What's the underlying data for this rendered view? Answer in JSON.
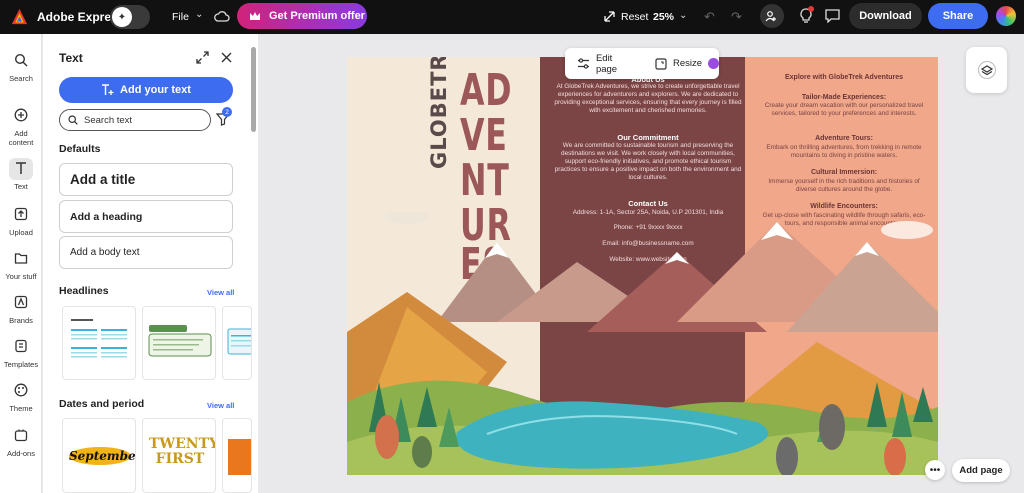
{
  "topbar": {
    "brand": "Adobe Express",
    "file_label": "File",
    "premium_label": "Get Premium offer",
    "reset_label": "Reset",
    "zoom_label": "25%",
    "download_label": "Download",
    "share_label": "Share"
  },
  "rail": {
    "items": [
      {
        "label": "Search",
        "icon": "search-icon"
      },
      {
        "label": "Add content",
        "icon": "plus-circle-icon"
      },
      {
        "label": "Text",
        "icon": "text-icon"
      },
      {
        "label": "Upload",
        "icon": "upload-icon"
      },
      {
        "label": "Your stuff",
        "icon": "folder-icon"
      },
      {
        "label": "Brands",
        "icon": "brand-icon"
      },
      {
        "label": "Templates",
        "icon": "templates-icon"
      },
      {
        "label": "Theme",
        "icon": "palette-icon"
      },
      {
        "label": "Add-ons",
        "icon": "addons-icon"
      }
    ]
  },
  "panel": {
    "title": "Text",
    "add_text_label": "Add your text",
    "search_placeholder": "Search text",
    "filter_count": "2",
    "defaults_heading": "Defaults",
    "defaults": {
      "title": "Add a title",
      "heading": "Add a heading",
      "body": "Add a body text"
    },
    "headlines_heading": "Headlines",
    "headlines_view_all": "View all",
    "dates_heading": "Dates and period",
    "dates_view_all": "View all",
    "date_thumbs": {
      "september": "September",
      "twenty_first": "TWENTY FIRST"
    }
  },
  "canvas": {
    "edit_page_label": "Edit page",
    "resize_label": "Resize",
    "add_page_label": "Add page"
  },
  "design": {
    "globetrek": "GLOBETREK",
    "adventures_lines": [
      "AD",
      "VE",
      "NT",
      "UR",
      "ES"
    ],
    "mid": {
      "about_heading": "About Us",
      "about_text": "At GlobeTrek Adventures, we strive to create unforgettable travel experiences for adventurers and explorers. We are dedicated to providing exceptional services, ensuring that every journey is filled with excitement and cherished memories.",
      "commitment_heading": "Our Commitment",
      "commitment_text": "We are committed to sustainable tourism and preserving the destinations we visit. We work closely with local communities, support eco-friendly initiatives, and promote ethical tourism practices to ensure a positive impact on both the environment and local cultures.",
      "contact_heading": "Contact Us",
      "address": "Address: 1-1A, Sector 25A, Noida, U.P 201301, India",
      "phone": "Phone: +91 9xxxx 9xxxx",
      "email": "Email: info@businessname.com",
      "website": "Website: www.website.com"
    },
    "right": {
      "explore": "Explore with GlobeTrek Adventures",
      "tailor_heading": "Tailor-Made Experiences:",
      "tailor_text": "Create your dream vacation with our personalized travel services, tailored to your preferences and interests.",
      "adventure_heading": "Adventure Tours:",
      "adventure_text": "Embark on thrilling adventures, from trekking in remote mountains to diving in pristine waters.",
      "cultural_heading": "Cultural Immersion:",
      "cultural_text": "Immerse yourself in the rich traditions and histories of diverse cultures around the globe.",
      "wildlife_heading": "Wildlife Encounters:",
      "wildlife_text": "Get up-close with fascinating wildlife through safaris, eco-tours, and responsible animal encounters."
    }
  },
  "colors": {
    "accent_blue": "#3e6cf0",
    "premium_gradient_start": "#d0237a",
    "premium_gradient_end": "#8a3be0",
    "design_maroon": "#7b4445",
    "design_peach": "#f0a78a",
    "design_cream": "#f4e9d8"
  }
}
